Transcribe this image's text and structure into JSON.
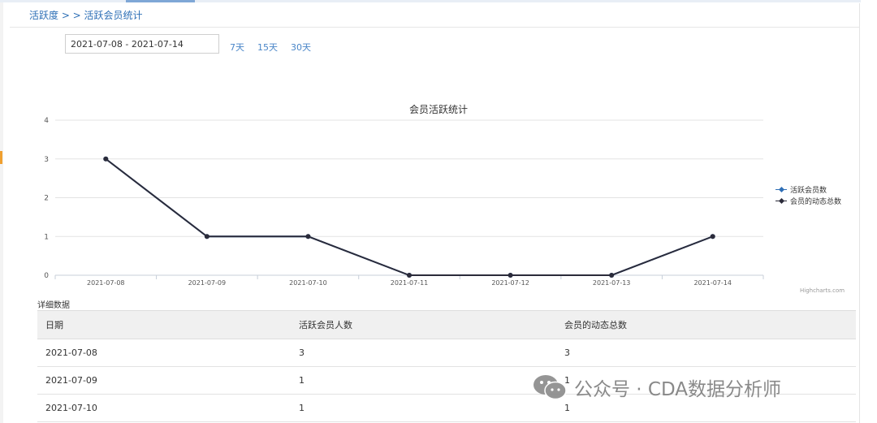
{
  "breadcrumb": {
    "text": "活跃度 > > 活跃会员统计"
  },
  "filters": {
    "date_range_value": "2021-07-08 - 2021-07-14",
    "quick_ranges": [
      "7天",
      "15天",
      "30天"
    ]
  },
  "chart_data": {
    "type": "line",
    "title": "会员活跃统计",
    "categories": [
      "2021-07-08",
      "2021-07-09",
      "2021-07-10",
      "2021-07-11",
      "2021-07-12",
      "2021-07-13",
      "2021-07-14"
    ],
    "series": [
      {
        "name": "活跃会员数",
        "values": [
          3,
          1,
          1,
          0,
          0,
          0,
          1
        ],
        "color": "#2f6fb6"
      },
      {
        "name": "会员的动态总数",
        "values": [
          3,
          1,
          1,
          0,
          0,
          0,
          1
        ],
        "color": "#2b2b3a"
      }
    ],
    "yticks": [
      0,
      1,
      2,
      3,
      4
    ],
    "ylim": [
      0,
      4
    ],
    "grid": true,
    "legend_position": "right",
    "credits": "Highcharts.com"
  },
  "details": {
    "section_label": "详细数据",
    "columns": [
      "日期",
      "活跃会员人数",
      "会员的动态总数"
    ],
    "rows": [
      [
        "2021-07-08",
        "3",
        "3"
      ],
      [
        "2021-07-09",
        "1",
        "1"
      ],
      [
        "2021-07-10",
        "1",
        "1"
      ]
    ]
  },
  "watermark": {
    "text": "公众号 · CDA数据分析师"
  }
}
